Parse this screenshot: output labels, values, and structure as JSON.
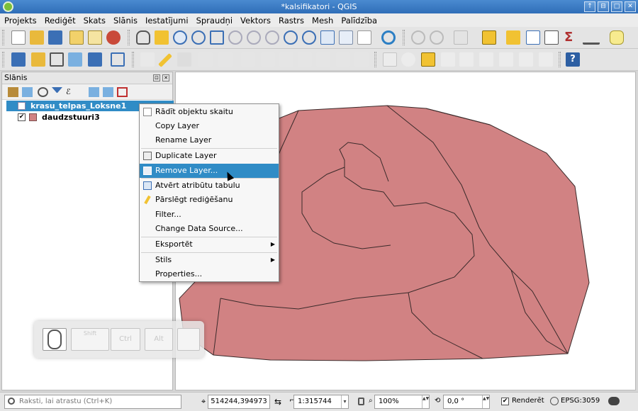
{
  "window": {
    "title": "*kalsifikatori - QGIS",
    "buttons": [
      "↑",
      "⊟",
      "□",
      "✕"
    ]
  },
  "menu": [
    "Projekts",
    "Rediģēt",
    "Skats",
    "Slānis",
    "Iestatījumi",
    "Spraudņi",
    "Vektors",
    "Rastrs",
    "Mesh",
    "Palīdzība"
  ],
  "layers_panel": {
    "title": "Slānis",
    "header_buttons": [
      "⊡",
      "✕"
    ],
    "layers": [
      {
        "name": "krasu_telpas_Loksne1",
        "checked": false
      },
      {
        "name": "daudzstuuri3",
        "checked": true,
        "check_mark": "✔",
        "color": "#d18283"
      }
    ]
  },
  "context_menu": {
    "items": [
      {
        "label": "Rādīt objektu skaitu",
        "icon": "checkbox-icon"
      },
      {
        "label": "Copy Layer"
      },
      {
        "label": "Rename Layer"
      },
      {
        "label": "Duplicate Layer",
        "icon": "duplicate-icon"
      },
      {
        "label": "Remove Layer...",
        "icon": "remove-icon",
        "highlighted": true
      },
      {
        "label": "Atvērt atribūtu tabulu",
        "icon": "table-icon"
      },
      {
        "label": "Pārslēgt rediģēšanu",
        "icon": "pencil-icon"
      },
      {
        "label": "Filter..."
      },
      {
        "label": "Change Data Source..."
      },
      {
        "label": "Eksportēt",
        "submenu": true
      },
      {
        "label": "Stils",
        "submenu": true
      },
      {
        "label": "Properties..."
      }
    ],
    "submenu_arrow": "▶"
  },
  "key_overlay": {
    "keys": [
      "Shift",
      "Ctrl",
      "Alt",
      ""
    ]
  },
  "map": {
    "polygon_fill": "#d18283",
    "stroke": "#3a2a2a"
  },
  "statusbar": {
    "search_placeholder": "Raksti, lai atrastu (Ctrl+K)",
    "coordinate": "514244,394973",
    "scale": "1:315744",
    "magnifier": "100%",
    "rotation": "0,0 °",
    "render_label": "Renderēt",
    "render_check": "✔",
    "crs": "EPSG:3059",
    "spin_arrows": "▲▼",
    "scale_arrow": "▾"
  }
}
